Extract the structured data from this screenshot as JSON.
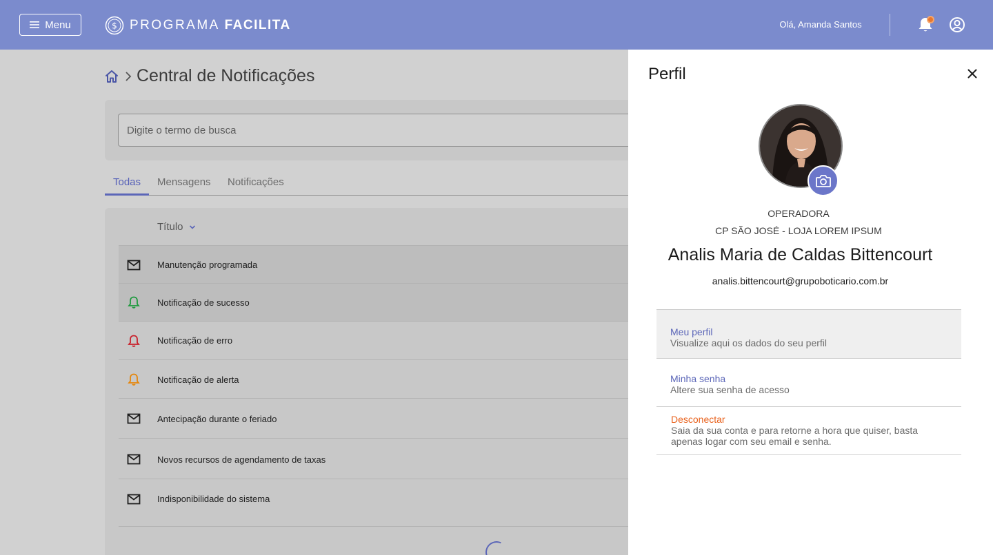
{
  "header": {
    "menu_label": "Menu",
    "logo_light": "PROGRAMA",
    "logo_bold": "FACILITA",
    "greeting": "Olá, Amanda Santos",
    "bell_icon": "bell-icon",
    "user_icon": "user-circle-icon",
    "background_color": "#7b8bcd",
    "badge_color": "#e8772e"
  },
  "main": {
    "breadcrumb_home_icon": "home-icon",
    "page_title": "Central de Notificações",
    "search": {
      "placeholder": "Digite o termo de busca",
      "value": ""
    },
    "tabs": [
      {
        "label": "Todas",
        "active": true
      },
      {
        "label": "Mensagens",
        "active": false
      },
      {
        "label": "Notificações",
        "active": false
      }
    ],
    "column_header": "Título",
    "rows": [
      {
        "icon": "mail-icon",
        "label": "Manutenção programada",
        "icon_color": "#1e1e1e"
      },
      {
        "icon": "bell-success-icon",
        "label": "Notificação de sucesso",
        "icon_color": "#1f9a3e"
      },
      {
        "icon": "bell-error-icon",
        "label": "Notificação de erro",
        "icon_color": "#c9202b"
      },
      {
        "icon": "bell-alert-icon",
        "label": "Notificação de alerta",
        "icon_color": "#e5860b"
      },
      {
        "icon": "mail-icon",
        "label": "Antecipação durante o feriado",
        "icon_color": "#1e1e1e"
      },
      {
        "icon": "mail-icon",
        "label": "Novos recursos de agendamento de taxas",
        "icon_color": "#1e1e1e"
      },
      {
        "icon": "mail-icon",
        "label": "Indisponibilidade do sistema",
        "icon_color": "#1e1e1e"
      }
    ]
  },
  "profile": {
    "title": "Perfil",
    "role": "OPERADORA",
    "store": "CP SÃO JOSÉ - LOJA LOREM IPSUM",
    "name": "Analis Maria de Caldas Bittencourt",
    "email": "analis.bittencourt@grupoboticario.com.br",
    "options": [
      {
        "title": "Meu perfil",
        "description": "Visualize aqui os dados do seu perfil"
      },
      {
        "title": "Minha senha",
        "description": "Altere sua senha de acesso"
      },
      {
        "title": "Desconectar",
        "description": "Saia da sua conta e para retorne a hora que quiser, basta apenas logar com seu email e senha."
      }
    ],
    "accent_color": "#5b66b8",
    "danger_color": "#e8611c"
  }
}
